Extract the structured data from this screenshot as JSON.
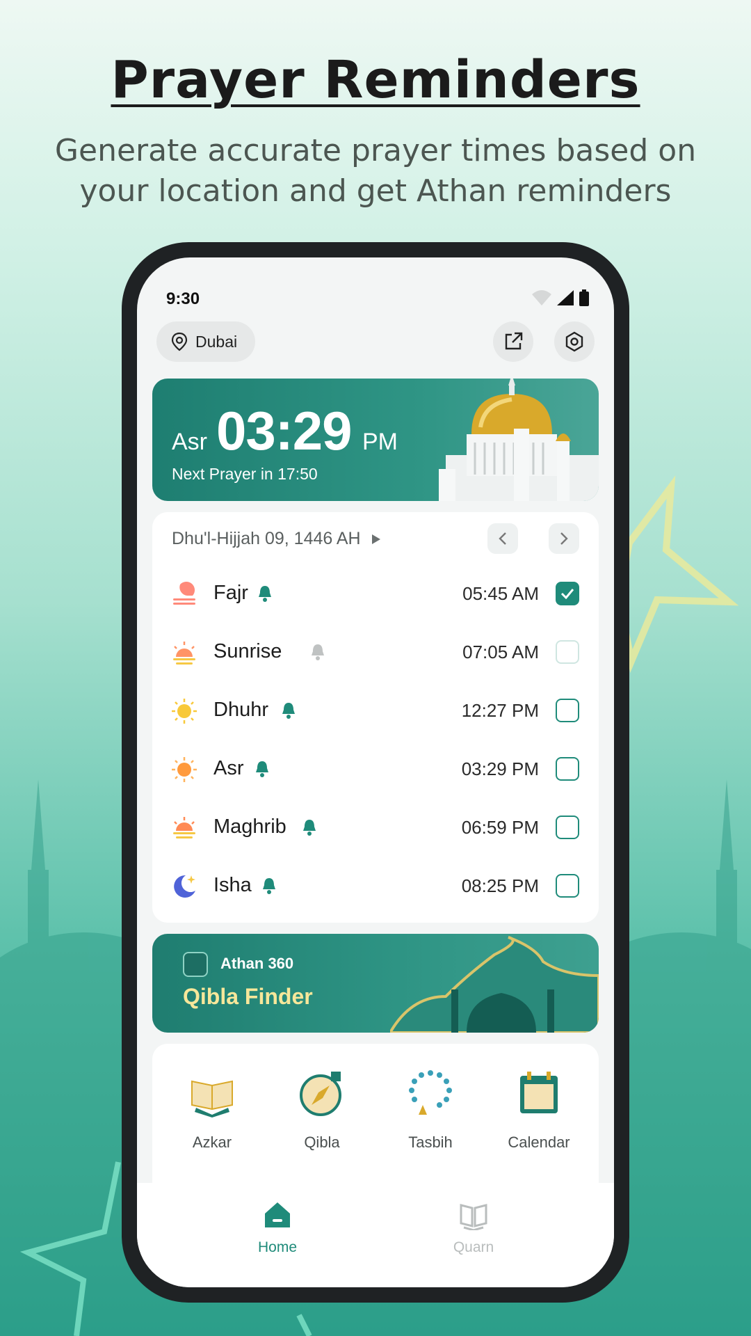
{
  "headline": "Prayer Reminders",
  "subline": "Generate accurate prayer times based on your location and get Athan reminders",
  "status": {
    "time": "9:30"
  },
  "location": {
    "label": "Dubai"
  },
  "hero": {
    "prayer": "Asr",
    "time": "03:29",
    "ampm": "PM",
    "next": "Next Prayer in 17:50"
  },
  "date": {
    "label": "Dhu'l-Hijjah 09, 1446 AH"
  },
  "prayers": [
    {
      "name": "Fajr",
      "time": "05:45 AM",
      "checked": true,
      "bell": "active"
    },
    {
      "name": "Sunrise",
      "time": "07:05 AM",
      "checked": false,
      "bell": "muted"
    },
    {
      "name": "Dhuhr",
      "time": "12:27 PM",
      "checked": false,
      "bell": "active"
    },
    {
      "name": "Asr",
      "time": "03:29 PM",
      "checked": false,
      "bell": "active"
    },
    {
      "name": "Maghrib",
      "time": "06:59 PM",
      "checked": false,
      "bell": "active"
    },
    {
      "name": "Isha",
      "time": "08:25 PM",
      "checked": false,
      "bell": "active"
    }
  ],
  "banner": {
    "brand": "Athan 360",
    "title": "Qibla Finder"
  },
  "tools": [
    {
      "label": "Azkar",
      "icon": "book-icon"
    },
    {
      "label": "Qibla",
      "icon": "compass-icon"
    },
    {
      "label": "Tasbih",
      "icon": "prayer-beads-icon"
    },
    {
      "label": "Calendar",
      "icon": "calendar-icon"
    }
  ],
  "nav": [
    {
      "label": "Home",
      "icon": "home-icon",
      "active": true
    },
    {
      "label": "Quarn",
      "icon": "quran-icon",
      "active": false
    }
  ],
  "colors": {
    "accent": "#1f8b7a",
    "banner_title": "#f7e79a",
    "inactive": "#b9bdbd"
  }
}
